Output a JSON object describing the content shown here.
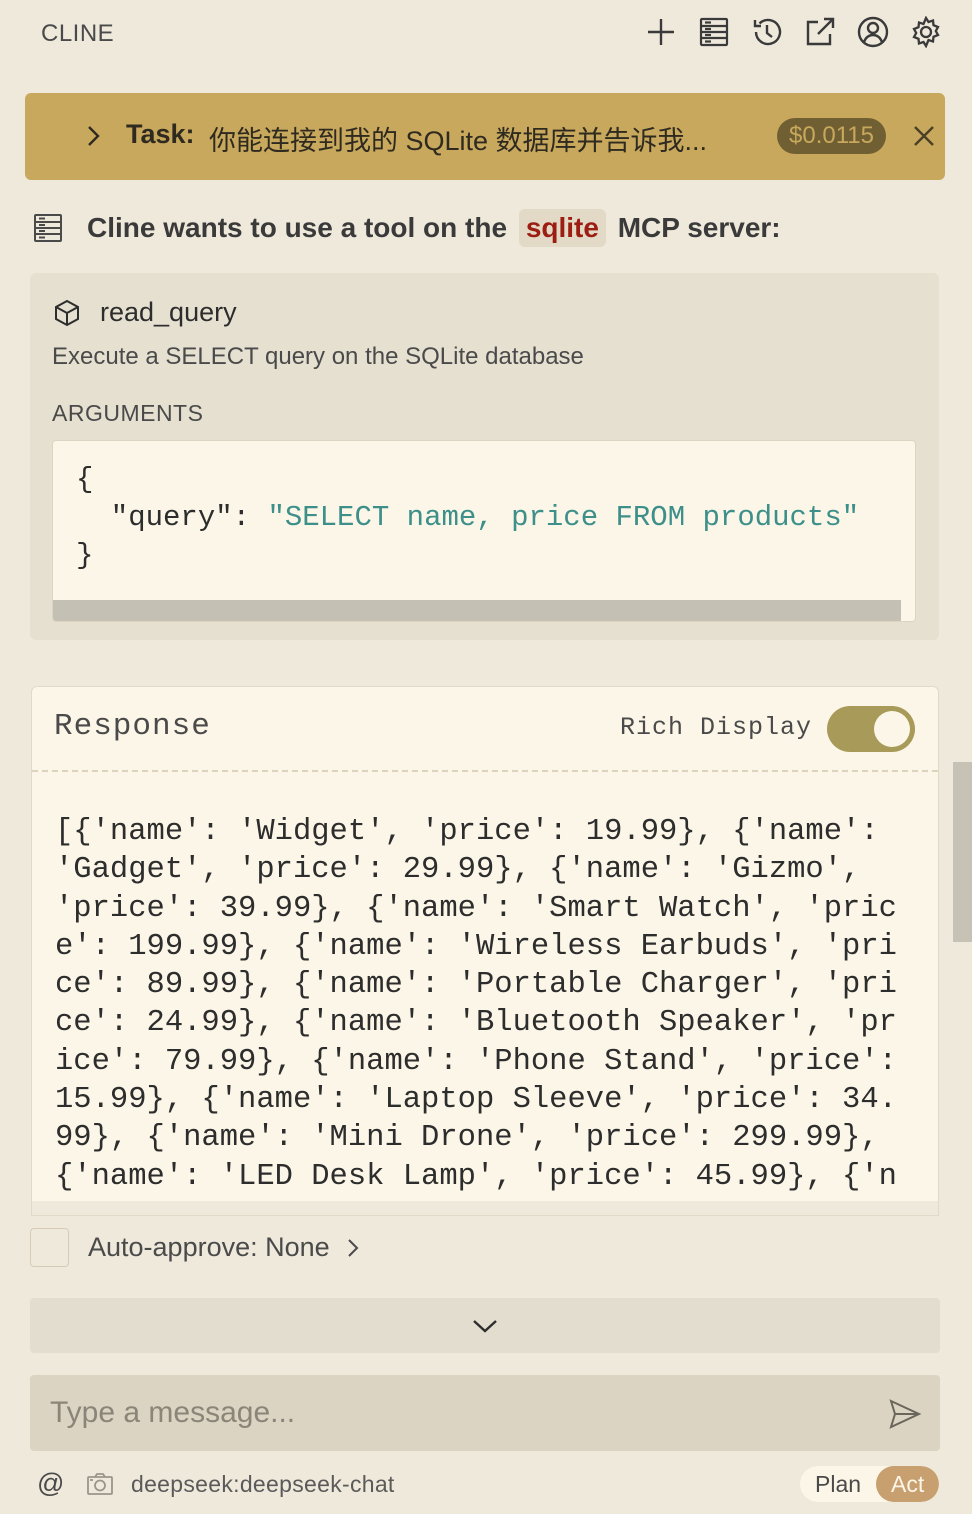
{
  "app": {
    "title": "CLINE"
  },
  "header_icons": [
    "plus-icon",
    "server-icon",
    "history-icon",
    "popout-icon",
    "account-icon",
    "gear-icon"
  ],
  "task": {
    "label": "Task:",
    "text": "你能连接到我的 SQLite 数据库并告诉我...",
    "cost": "$0.0115"
  },
  "tool_use": {
    "prefix": "Cline wants to use a tool on the",
    "server": "sqlite",
    "suffix": "MCP server:"
  },
  "tool": {
    "name": "read_query",
    "description": "Execute a SELECT query on the SQLite database",
    "arguments_label": "ARGUMENTS",
    "arg_open": "{",
    "arg_key": "  \"query\": ",
    "arg_value": "\"SELECT name, price FROM products\"",
    "arg_close": "}"
  },
  "response": {
    "title": "Response",
    "rich_display_label": "Rich Display",
    "rich_display_on": true,
    "body": "[{'name': 'Widget', 'price': 19.99}, {'name': 'Gadget', 'price': 29.99}, {'name': 'Gizmo', 'price': 39.99}, {'name': 'Smart Watch', 'price': 199.99}, {'name': 'Wireless Earbuds', 'price': 89.99}, {'name': 'Portable Charger', 'price': 24.99}, {'name': 'Bluetooth Speaker', 'price': 79.99}, {'name': 'Phone Stand', 'price': 15.99}, {'name': 'Laptop Sleeve', 'price': 34.99}, {'name': 'Mini Drone', 'price': 299.99}, {'name': 'LED Desk Lamp', 'price': 45.99}, {'n"
  },
  "auto_approve": {
    "label": "Auto-approve: None"
  },
  "input": {
    "placeholder": "Type a message..."
  },
  "footer": {
    "at_symbol": "@",
    "model": "deepseek:deepseek-chat",
    "modes": [
      "Plan",
      "Act"
    ],
    "active_mode": "Act"
  },
  "colors": {
    "background": "#efe9dc",
    "task_banner": "#c8a85c",
    "server_pill_text": "#9c1d12",
    "toggle_on": "#a89a58",
    "string_literal": "#3d8f8a"
  }
}
